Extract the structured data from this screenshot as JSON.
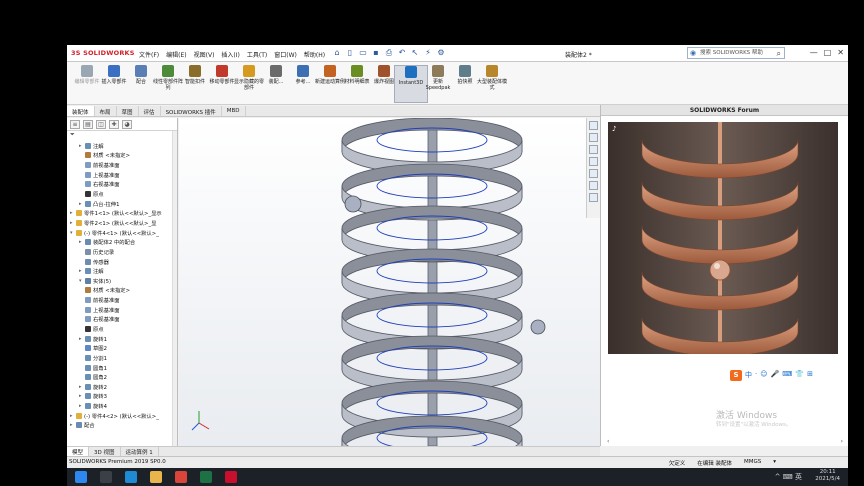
{
  "app": {
    "logo_text": "3S SOLIDWORKS",
    "document_title": "装配体2 *",
    "search_placeholder": "搜索 SOLIDWORKS 帮助",
    "menus": [
      "文件(F)",
      "编辑(E)",
      "视图(V)",
      "插入(I)",
      "工具(T)",
      "窗口(W)",
      "帮助(H)"
    ],
    "window_controls": [
      "—",
      "□",
      "✕"
    ]
  },
  "command_manager": {
    "buttons": [
      {
        "label": "编辑零部件",
        "dim": true,
        "color": "#9aa6b2"
      },
      {
        "label": "插入零部件",
        "dim": false,
        "color": "#3a6fc4"
      },
      {
        "label": "配合",
        "dim": false,
        "color": "#5a7fb5"
      },
      {
        "label": "线性零部件阵列",
        "dim": false,
        "color": "#4d8b3a"
      },
      {
        "label": "智能扣件",
        "dim": false,
        "color": "#8a6d2a"
      },
      {
        "label": "移动零部件",
        "dim": false,
        "color": "#c0392b"
      },
      {
        "label": "显示隐藏的零部件",
        "dim": false,
        "color": "#d79a21"
      },
      {
        "label": "装配...",
        "dim": false,
        "color": "#6b6b6b"
      },
      {
        "label": "参考...",
        "dim": false,
        "color": "#3d6fb3"
      },
      {
        "label": "新建运动算例",
        "dim": false,
        "color": "#c46321"
      },
      {
        "label": "材料明细表",
        "dim": false,
        "color": "#6b8e23"
      },
      {
        "label": "爆炸视图",
        "dim": false,
        "color": "#a0522d"
      },
      {
        "label": "Instant3D",
        "dim": false,
        "color": "#1e6fbf",
        "active": true
      },
      {
        "label": "更新Speedpak",
        "dim": false,
        "color": "#8d7b5a"
      },
      {
        "label": "拍快照",
        "dim": false,
        "color": "#607d8b"
      },
      {
        "label": "大型装配体模式",
        "dim": false,
        "color": "#b8862b"
      }
    ],
    "extra_labels": [
      "隐藏/显示零部件",
      "带从属零部件",
      "更新Speedpak"
    ]
  },
  "tabs": [
    {
      "label": "装配体",
      "active": true
    },
    {
      "label": "布局",
      "active": false
    },
    {
      "label": "草图",
      "active": false
    },
    {
      "label": "评估",
      "active": false
    },
    {
      "label": "SOLIDWORKS 插件",
      "active": false
    },
    {
      "label": "MBD",
      "active": false
    }
  ],
  "feature_manager": {
    "filter_icon": "filter-icon",
    "rows": [
      {
        "indent": 1,
        "expand": "▸",
        "icon_color": "#6a8fb5",
        "label": "注解"
      },
      {
        "indent": 1,
        "expand": "",
        "icon_color": "#b07b3c",
        "label": "材质 <未指定>"
      },
      {
        "indent": 1,
        "expand": "",
        "icon_color": "#7e9cc2",
        "label": "前视基准面"
      },
      {
        "indent": 1,
        "expand": "",
        "icon_color": "#7e9cc2",
        "label": "上视基准面"
      },
      {
        "indent": 1,
        "expand": "",
        "icon_color": "#7e9cc2",
        "label": "右视基准面"
      },
      {
        "indent": 1,
        "expand": "",
        "icon_color": "#333333",
        "label": "原点"
      },
      {
        "indent": 1,
        "expand": "▸",
        "icon_color": "#6a8fb5",
        "label": "凸台-拉伸1"
      },
      {
        "indent": 0,
        "expand": "▸",
        "icon_color": "#e0b03a",
        "label": "零件1<1> (默认<<默认>_显示"
      },
      {
        "indent": 0,
        "expand": "▸",
        "icon_color": "#e0b03a",
        "label": "零件2<1> (默认<<默认>_显"
      },
      {
        "indent": 0,
        "expand": "▾",
        "icon_color": "#e0b03a",
        "label": "(-) 零件4<1> (默认<<默认>_"
      },
      {
        "indent": 1,
        "expand": "▸",
        "icon_color": "#6b8ab0",
        "label": "装配体2 中的配合"
      },
      {
        "indent": 1,
        "expand": "",
        "icon_color": "#7a8fa8",
        "label": "历史记录"
      },
      {
        "indent": 1,
        "expand": "",
        "icon_color": "#6c8db0",
        "label": "传感器"
      },
      {
        "indent": 1,
        "expand": "▸",
        "icon_color": "#6a8fb5",
        "label": "注解"
      },
      {
        "indent": 1,
        "expand": "▾",
        "icon_color": "#5f7fa3",
        "label": "实体(5)"
      },
      {
        "indent": 1,
        "expand": "",
        "icon_color": "#b07b3c",
        "label": "材质 <未指定>"
      },
      {
        "indent": 1,
        "expand": "",
        "icon_color": "#7e9cc2",
        "label": "前视基准面"
      },
      {
        "indent": 1,
        "expand": "",
        "icon_color": "#7e9cc2",
        "label": "上视基准面"
      },
      {
        "indent": 1,
        "expand": "",
        "icon_color": "#7e9cc2",
        "label": "右视基准面"
      },
      {
        "indent": 1,
        "expand": "",
        "icon_color": "#333333",
        "label": "原点"
      },
      {
        "indent": 1,
        "expand": "▸",
        "icon_color": "#6a8fb5",
        "label": "旋转1"
      },
      {
        "indent": 1,
        "expand": "",
        "icon_color": "#5c88c6",
        "label": "草图2"
      },
      {
        "indent": 1,
        "expand": "",
        "icon_color": "#6a8fb5",
        "label": "分割1"
      },
      {
        "indent": 1,
        "expand": "",
        "icon_color": "#6a8fb5",
        "label": "圆角1"
      },
      {
        "indent": 1,
        "expand": "",
        "icon_color": "#6a8fb5",
        "label": "圆角2"
      },
      {
        "indent": 1,
        "expand": "▸",
        "icon_color": "#6a8fb5",
        "label": "旋转2"
      },
      {
        "indent": 1,
        "expand": "▸",
        "icon_color": "#6a8fb5",
        "label": "旋转3"
      },
      {
        "indent": 1,
        "expand": "▸",
        "icon_color": "#6a8fb5",
        "label": "旋转4"
      },
      {
        "indent": 0,
        "expand": "▸",
        "icon_color": "#e0b03a",
        "label": "(-) 零件4<2> (默认<<默认>_"
      },
      {
        "indent": 0,
        "expand": "▸",
        "icon_color": "#6b8ab0",
        "label": "配合"
      }
    ]
  },
  "forum": {
    "title": "SOLIDWORKS Forum",
    "video_overlay": "tiktok",
    "ime_icons": [
      "S",
      "中",
      "·",
      "☺",
      "🎤",
      "⌨",
      "👕",
      "⊞"
    ],
    "watermark": "激活 Windows",
    "watermark_sub": "转到\"设置\"以激活 Windows。"
  },
  "model_tabs": [
    {
      "label": "模型",
      "active": true
    },
    {
      "label": "3D 视图",
      "active": false
    },
    {
      "label": "运动算例 1",
      "active": false
    }
  ],
  "status_bar": {
    "left": "SOLIDWORKS Premium 2019 SP0.0",
    "right": [
      "欠定义",
      "在编辑 装配体",
      "MMGS",
      "▾"
    ]
  },
  "taskbar": {
    "time": "20:11",
    "date": "2021/5/4",
    "apps": [
      {
        "name": "start-button",
        "color": "#2d89ef"
      },
      {
        "name": "search",
        "color": "#3b3f46"
      },
      {
        "name": "edge-icon",
        "color": "#1f8bd4"
      },
      {
        "name": "file-explorer-icon",
        "color": "#e8b64b"
      },
      {
        "name": "chrome-icon",
        "color": "#d9443b"
      },
      {
        "name": "excel-icon",
        "color": "#1e7145"
      },
      {
        "name": "solidworks-icon",
        "color": "#c8102e"
      }
    ],
    "tray": "^ ⌨ 英"
  },
  "colors": {
    "spiral": "#8a8f9a",
    "spiral_dark": "#555a66",
    "ball": "#9ba3b5",
    "copper": "#c27a57"
  }
}
